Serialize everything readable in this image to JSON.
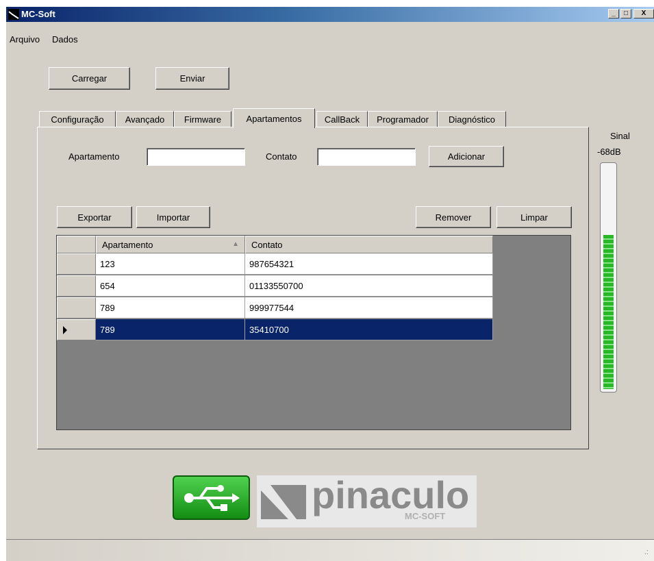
{
  "window": {
    "title": "MC-Soft"
  },
  "menu": {
    "items": [
      "Arquivo",
      "Dados"
    ]
  },
  "toolbar": {
    "load_label": "Carregar",
    "send_label": "Enviar"
  },
  "tabs": [
    "Configuração",
    "Avançado",
    "Firmware",
    "Apartamentos",
    "CallBack",
    "Programador",
    "Diagnóstico"
  ],
  "active_tab": "Apartamentos",
  "form": {
    "apartment_label": "Apartamento",
    "apartment_value": "",
    "contact_label": "Contato",
    "contact_value": "",
    "add_label": "Adicionar"
  },
  "actions": {
    "export_label": "Exportar",
    "import_label": "Importar",
    "remove_label": "Remover",
    "clear_label": "Limpar"
  },
  "grid": {
    "columns": [
      "Apartamento",
      "Contato"
    ],
    "sort_indicator": "▲",
    "rows": [
      {
        "apartamento": "123",
        "contato": "987654321"
      },
      {
        "apartamento": "654",
        "contato": "01133550700"
      },
      {
        "apartamento": "789",
        "contato": "999977544"
      },
      {
        "apartamento": "789",
        "contato": "35410700"
      }
    ],
    "selected_row": 3
  },
  "signal": {
    "label": "Sinal",
    "value": "-68dB",
    "level_percent": 69
  },
  "branding": {
    "name": "pinaculo",
    "sub": "MC-SOFT"
  },
  "colors": {
    "selection": "#0a246a",
    "meter": "#27b827",
    "usb": "#1a9e1a"
  }
}
